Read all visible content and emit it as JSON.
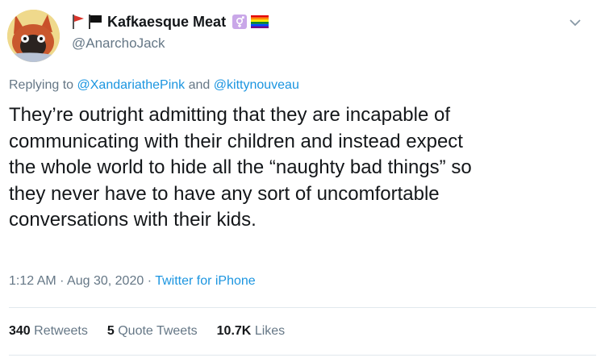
{
  "user": {
    "display_name": "Kafkaesque Meat",
    "handle": "@AnarchoJack",
    "avatar": "cartoon-fox-avatar",
    "flags": [
      "red-flag-icon",
      "black-flag-icon"
    ],
    "badges": [
      "trans-symbol-badge-icon",
      "rainbow-flag-icon"
    ]
  },
  "reply": {
    "prefix": "Replying to",
    "users": [
      "@XandariathePink",
      "@kittynouveau"
    ],
    "joiner": "and"
  },
  "tweet": {
    "lines": [
      "They’re outright admitting that they are incapable of",
      "communicating with their children and instead expect",
      "the whole world to hide all the “naughty bad things” so",
      "they never have to have any sort of uncomfortable",
      "conversations with their kids."
    ]
  },
  "meta": {
    "time": "1:12 AM",
    "date": "Aug 30, 2020",
    "separator": "·",
    "source": "Twitter for iPhone"
  },
  "stats": {
    "retweets_count": "340",
    "retweets_label": "Retweets",
    "quotes_count": "5",
    "quotes_label": "Quote Tweets",
    "likes_count": "10.7K",
    "likes_label": "Likes"
  },
  "colors": {
    "link": "#1b95e0",
    "muted": "#657786",
    "text": "#14171a",
    "divider": "#e1e8ed"
  }
}
